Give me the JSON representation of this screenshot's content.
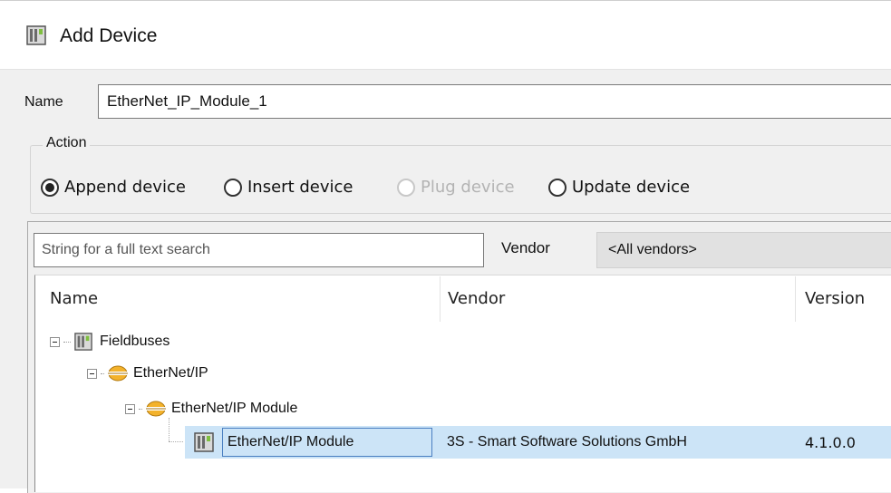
{
  "window": {
    "title": "Add Device",
    "icon": "device-module-icon"
  },
  "name_field": {
    "label": "Name",
    "value": "EtherNet_IP_Module_1"
  },
  "action": {
    "legend": "Action",
    "options": [
      {
        "label": "Append device",
        "checked": true,
        "enabled": true
      },
      {
        "label": "Insert device",
        "checked": false,
        "enabled": true
      },
      {
        "label": "Plug device",
        "checked": false,
        "enabled": false
      },
      {
        "label": "Update device",
        "checked": false,
        "enabled": true
      }
    ]
  },
  "search": {
    "placeholder": "String for a full text search"
  },
  "vendor_filter": {
    "label": "Vendor",
    "selected": "<All vendors>"
  },
  "table": {
    "columns": [
      "Name",
      "Vendor",
      "Version"
    ],
    "tree": [
      {
        "label": "Fieldbuses",
        "icon": "fieldbus-module-icon"
      },
      {
        "label": "EtherNet/IP",
        "icon": "ethernet-ip-icon"
      },
      {
        "label": "EtherNet/IP Module",
        "icon": "ethernet-ip-icon"
      },
      {
        "label": "EtherNet/IP Module",
        "icon": "device-module-icon",
        "vendor": "3S - Smart Software Solutions GmbH",
        "version": "4.1.0.0",
        "selected": true
      }
    ]
  },
  "colors": {
    "selection": "#cce4f7",
    "dialog_bg": "#f0f0f0",
    "ethernet_icon": "#f0a81e"
  }
}
